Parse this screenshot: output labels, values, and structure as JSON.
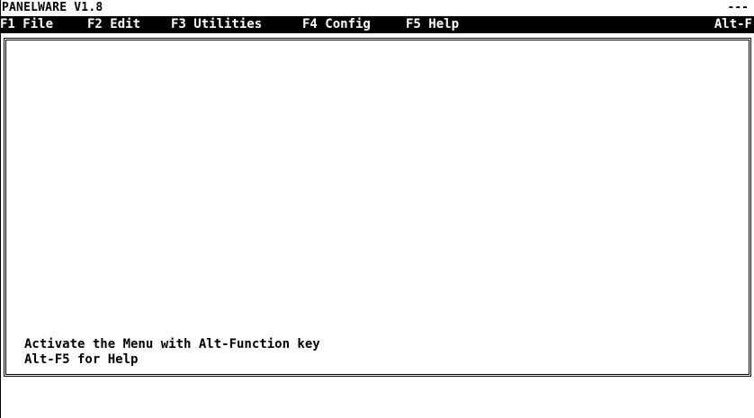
{
  "title_bar": {
    "app_name": "PANELWARE  V1.8",
    "right_indicator": "---"
  },
  "menu_bar": {
    "items": [
      {
        "label": "F1 File"
      },
      {
        "label": "F2 Edit"
      },
      {
        "label": "F3 Utilities"
      },
      {
        "label": "F4 Config"
      },
      {
        "label": "F5 Help"
      }
    ],
    "right_hint": "Alt-F"
  },
  "main": {
    "status_lines": [
      "Activate the Menu with Alt-Function key",
      "Alt-F5 for Help"
    ]
  },
  "colors": {
    "background": "#ffffff",
    "foreground": "#000000",
    "menu_background": "#000000",
    "menu_foreground": "#ffffff"
  }
}
